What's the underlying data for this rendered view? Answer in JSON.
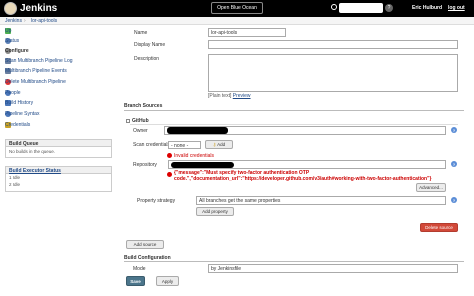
{
  "header": {
    "title": "Jenkins",
    "open_blue_ocean": "Open Blue Ocean",
    "help": "?",
    "user": "Eric Hulburd",
    "logout": "log out"
  },
  "breadcrumbs": [
    "Jenkins",
    "lor-api-tools"
  ],
  "sidebar": {
    "items": [
      {
        "label": "Up",
        "icon": "up-arrow-icon",
        "color": "#4caf50"
      },
      {
        "label": "Status",
        "icon": "search-icon",
        "color": "#5a7fb5"
      },
      {
        "label": "Configure",
        "icon": "gear-icon",
        "color": "#888888"
      },
      {
        "label": "Scan Multibranch Pipeline Log",
        "icon": "log-icon",
        "color": "#6a7fa0"
      },
      {
        "label": "Multibranch Pipeline Events",
        "icon": "log-icon",
        "color": "#6a7fa0"
      },
      {
        "label": "Delete Multibranch Pipeline",
        "icon": "delete-icon",
        "color": "#d33"
      },
      {
        "label": "People",
        "icon": "people-icon",
        "color": "#4a76b8"
      },
      {
        "label": "Build History",
        "icon": "history-icon",
        "color": "#4a76b8"
      },
      {
        "label": "Pipeline Syntax",
        "icon": "help-icon",
        "color": "#4a76b8"
      },
      {
        "label": "Credentials",
        "icon": "key-icon",
        "color": "#c9a227"
      }
    ],
    "build_queue": {
      "title": "Build Queue",
      "message": "No builds in the queue."
    },
    "executor": {
      "title": "Build Executor Status",
      "rows": [
        "1  Idle",
        "2  Idle"
      ]
    }
  },
  "form": {
    "name_label": "Name",
    "name_value": "lor-api-tools",
    "display_name_label": "Display Name",
    "description_label": "Description",
    "plain_text": "[Plain text]",
    "preview": "Preview",
    "branch_sources_title": "Branch Sources",
    "github_label": "GitHub",
    "owner_label": "Owner",
    "scan_credentials_label": "Scan credentials",
    "scan_credentials_value": "- none -",
    "add_button": "Add",
    "invalid_credentials": "Invalid credentials",
    "repository_label": "Repository",
    "error_message": "{\"message\":\"Must specify two-factor authentication OTP code.\",\"documentation_url\":\"https://developer.github.com/v3/auth#working-with-two-factor-authentication\"}",
    "advanced_button": "Advanced...",
    "property_strategy_label": "Property strategy",
    "property_strategy_value": "All branches get the same properties",
    "add_property_button": "Add property",
    "delete_source_button": "Delete source",
    "add_source_button": "Add source",
    "build_configuration_title": "Build Configuration",
    "mode_label": "Mode",
    "mode_value": "by Jenkinsfile",
    "save_button": "Save",
    "apply_button": "Apply"
  }
}
